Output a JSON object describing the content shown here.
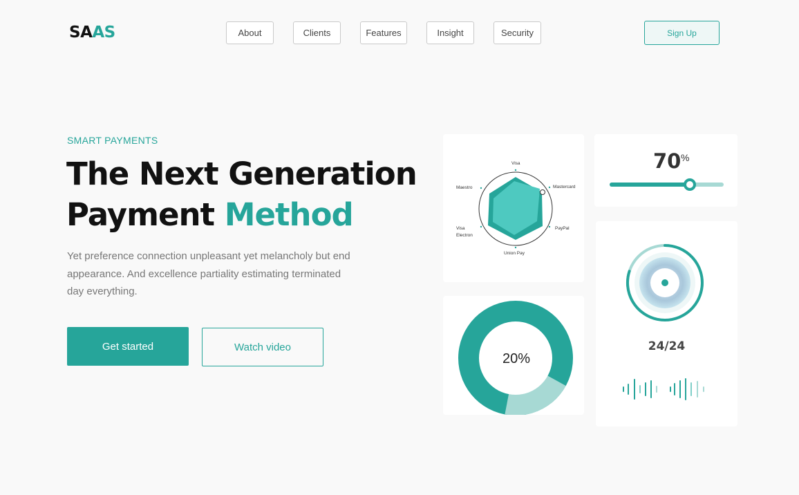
{
  "brand": {
    "logo_part1": "SA",
    "logo_part2": "AS"
  },
  "nav": {
    "items": [
      {
        "label": "About"
      },
      {
        "label": "Clients"
      },
      {
        "label": "Features"
      },
      {
        "label": "Insight"
      },
      {
        "label": "Security"
      }
    ],
    "signup_label": "Sign Up"
  },
  "hero": {
    "eyebrow": "SMART PAYMENTS",
    "headline_line1": "The Next Generation",
    "headline_line2_plain": "Payment",
    "headline_line2_accent": "Method",
    "description": "Yet preference connection unpleasant yet melancholy but end appearance. And excellence partiality estimating terminated day everything.",
    "primary_button": "Get started",
    "secondary_button": "Watch video"
  },
  "radar_card": {
    "axes": [
      "Visa",
      "Mastercard",
      "PayPal",
      "Union Pay",
      "Visa Electron",
      "Maestro"
    ]
  },
  "slider_card": {
    "value": 70,
    "value_text": "70",
    "unit": "%"
  },
  "donut_card": {
    "label": "20%",
    "highlight_fraction": 0.2
  },
  "player_card": {
    "track_count": "24/24",
    "progress_fraction": 0.8
  },
  "colors": {
    "accent": "#26a59a",
    "accent_light": "#a7d9d4",
    "radar_fill": "#4ec9c0",
    "background": "#f9f9f9"
  },
  "icons": {
    "waveform": "audio-waveform-icon",
    "disc": "audio-disc-icon"
  }
}
